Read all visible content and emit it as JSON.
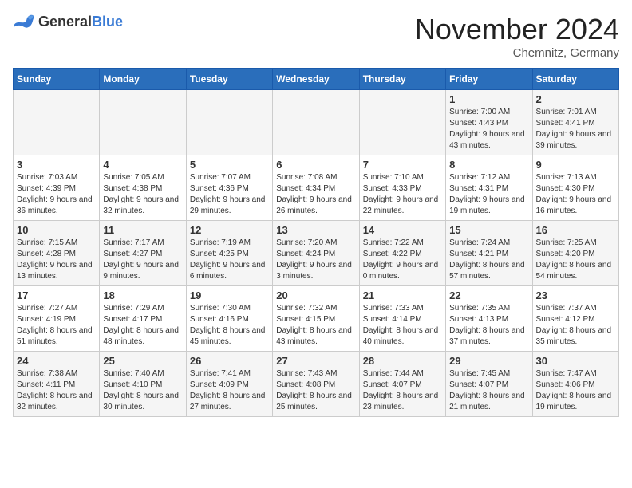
{
  "logo": {
    "general": "General",
    "blue": "Blue"
  },
  "title": "November 2024",
  "subtitle": "Chemnitz, Germany",
  "headers": [
    "Sunday",
    "Monday",
    "Tuesday",
    "Wednesday",
    "Thursday",
    "Friday",
    "Saturday"
  ],
  "weeks": [
    [
      {
        "day": "",
        "detail": ""
      },
      {
        "day": "",
        "detail": ""
      },
      {
        "day": "",
        "detail": ""
      },
      {
        "day": "",
        "detail": ""
      },
      {
        "day": "",
        "detail": ""
      },
      {
        "day": "1",
        "detail": "Sunrise: 7:00 AM\nSunset: 4:43 PM\nDaylight: 9 hours and 43 minutes."
      },
      {
        "day": "2",
        "detail": "Sunrise: 7:01 AM\nSunset: 4:41 PM\nDaylight: 9 hours and 39 minutes."
      }
    ],
    [
      {
        "day": "3",
        "detail": "Sunrise: 7:03 AM\nSunset: 4:39 PM\nDaylight: 9 hours and 36 minutes."
      },
      {
        "day": "4",
        "detail": "Sunrise: 7:05 AM\nSunset: 4:38 PM\nDaylight: 9 hours and 32 minutes."
      },
      {
        "day": "5",
        "detail": "Sunrise: 7:07 AM\nSunset: 4:36 PM\nDaylight: 9 hours and 29 minutes."
      },
      {
        "day": "6",
        "detail": "Sunrise: 7:08 AM\nSunset: 4:34 PM\nDaylight: 9 hours and 26 minutes."
      },
      {
        "day": "7",
        "detail": "Sunrise: 7:10 AM\nSunset: 4:33 PM\nDaylight: 9 hours and 22 minutes."
      },
      {
        "day": "8",
        "detail": "Sunrise: 7:12 AM\nSunset: 4:31 PM\nDaylight: 9 hours and 19 minutes."
      },
      {
        "day": "9",
        "detail": "Sunrise: 7:13 AM\nSunset: 4:30 PM\nDaylight: 9 hours and 16 minutes."
      }
    ],
    [
      {
        "day": "10",
        "detail": "Sunrise: 7:15 AM\nSunset: 4:28 PM\nDaylight: 9 hours and 13 minutes."
      },
      {
        "day": "11",
        "detail": "Sunrise: 7:17 AM\nSunset: 4:27 PM\nDaylight: 9 hours and 9 minutes."
      },
      {
        "day": "12",
        "detail": "Sunrise: 7:19 AM\nSunset: 4:25 PM\nDaylight: 9 hours and 6 minutes."
      },
      {
        "day": "13",
        "detail": "Sunrise: 7:20 AM\nSunset: 4:24 PM\nDaylight: 9 hours and 3 minutes."
      },
      {
        "day": "14",
        "detail": "Sunrise: 7:22 AM\nSunset: 4:22 PM\nDaylight: 9 hours and 0 minutes."
      },
      {
        "day": "15",
        "detail": "Sunrise: 7:24 AM\nSunset: 4:21 PM\nDaylight: 8 hours and 57 minutes."
      },
      {
        "day": "16",
        "detail": "Sunrise: 7:25 AM\nSunset: 4:20 PM\nDaylight: 8 hours and 54 minutes."
      }
    ],
    [
      {
        "day": "17",
        "detail": "Sunrise: 7:27 AM\nSunset: 4:19 PM\nDaylight: 8 hours and 51 minutes."
      },
      {
        "day": "18",
        "detail": "Sunrise: 7:29 AM\nSunset: 4:17 PM\nDaylight: 8 hours and 48 minutes."
      },
      {
        "day": "19",
        "detail": "Sunrise: 7:30 AM\nSunset: 4:16 PM\nDaylight: 8 hours and 45 minutes."
      },
      {
        "day": "20",
        "detail": "Sunrise: 7:32 AM\nSunset: 4:15 PM\nDaylight: 8 hours and 43 minutes."
      },
      {
        "day": "21",
        "detail": "Sunrise: 7:33 AM\nSunset: 4:14 PM\nDaylight: 8 hours and 40 minutes."
      },
      {
        "day": "22",
        "detail": "Sunrise: 7:35 AM\nSunset: 4:13 PM\nDaylight: 8 hours and 37 minutes."
      },
      {
        "day": "23",
        "detail": "Sunrise: 7:37 AM\nSunset: 4:12 PM\nDaylight: 8 hours and 35 minutes."
      }
    ],
    [
      {
        "day": "24",
        "detail": "Sunrise: 7:38 AM\nSunset: 4:11 PM\nDaylight: 8 hours and 32 minutes."
      },
      {
        "day": "25",
        "detail": "Sunrise: 7:40 AM\nSunset: 4:10 PM\nDaylight: 8 hours and 30 minutes."
      },
      {
        "day": "26",
        "detail": "Sunrise: 7:41 AM\nSunset: 4:09 PM\nDaylight: 8 hours and 27 minutes."
      },
      {
        "day": "27",
        "detail": "Sunrise: 7:43 AM\nSunset: 4:08 PM\nDaylight: 8 hours and 25 minutes."
      },
      {
        "day": "28",
        "detail": "Sunrise: 7:44 AM\nSunset: 4:07 PM\nDaylight: 8 hours and 23 minutes."
      },
      {
        "day": "29",
        "detail": "Sunrise: 7:45 AM\nSunset: 4:07 PM\nDaylight: 8 hours and 21 minutes."
      },
      {
        "day": "30",
        "detail": "Sunrise: 7:47 AM\nSunset: 4:06 PM\nDaylight: 8 hours and 19 minutes."
      }
    ]
  ]
}
